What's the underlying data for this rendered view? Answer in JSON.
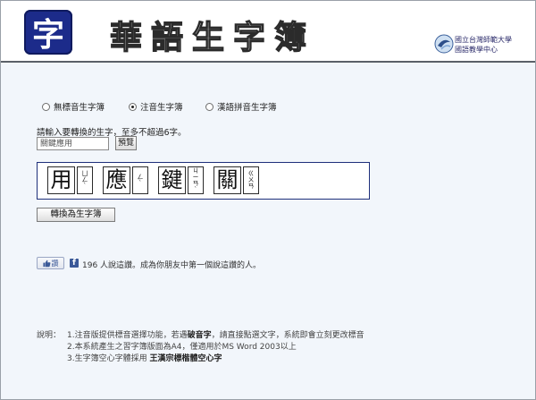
{
  "header": {
    "logo_char": "字",
    "title": "華語生字簿",
    "university_line1": "國立台灣師範大學",
    "university_line2": "國語教學中心"
  },
  "mode_options": [
    {
      "label": "無標音生字簿",
      "checked": false
    },
    {
      "label": "注音生字簿",
      "checked": true
    },
    {
      "label": "漢語拼音生字簿",
      "checked": false
    }
  ],
  "input": {
    "prompt": "請輸入要轉換的生字，至多不超過6字。",
    "value": "關鍵應用",
    "preview_label": "預覽"
  },
  "preview": {
    "cells": [
      {
        "char": "用",
        "zhuyin": [
          "ㄩ",
          "ㄥ"
        ],
        "tone": "ˋ"
      },
      {
        "char": "應",
        "zhuyin": [
          "ㄥ"
        ],
        "tone": "ˋ"
      },
      {
        "char": "鍵",
        "zhuyin": [
          "ㄐ",
          "ㄧ",
          "ㄢ"
        ],
        "tone": "ˋ"
      },
      {
        "char": "關",
        "zhuyin": [
          "ㄍ",
          "ㄨ",
          "ㄢ"
        ],
        "tone": ""
      }
    ]
  },
  "convert_label": "轉換為生字簿",
  "facebook": {
    "like_label": "讚",
    "text": "196 人說這讚。成為你朋友中第一個說這讚的人。"
  },
  "notes": {
    "label": "說明：",
    "items": [
      {
        "prefix": "1.注音版提供標音選擇功能，若遇",
        "bold": "破音字",
        "suffix": "，請直接點選文字，系統即會立刻更改標音"
      },
      {
        "prefix": "2.本系統產生之習字簿版面為A4，僅適用於MS Word 2003以上",
        "bold": "",
        "suffix": ""
      },
      {
        "prefix": "3.生字簿空心字體採用 ",
        "bold": "王漢宗標楷體空心字",
        "suffix": ""
      }
    ]
  },
  "colors": {
    "logo_bg": "#1c2b8a",
    "preview_border": "#1e2f7a",
    "page_bg": "#f2f6fb",
    "facebook": "#3b5998"
  }
}
